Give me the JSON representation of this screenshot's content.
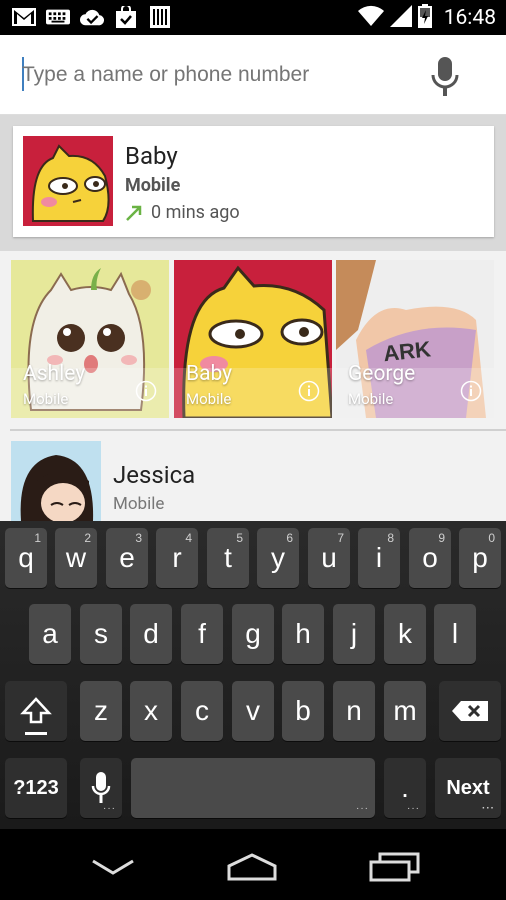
{
  "status_bar": {
    "time": "16:48",
    "left_icons": [
      "gmail-icon",
      "keyboard-icon",
      "check-cloud-icon",
      "shopping-bag-icon",
      "barcode-icon"
    ],
    "right_icons": [
      "wifi-icon",
      "cell-signal-icon",
      "battery-icon"
    ]
  },
  "search": {
    "placeholder": "Type a name or phone number",
    "value": ""
  },
  "recent": {
    "name": "Baby",
    "type": "Mobile",
    "time": "0 mins ago",
    "arrow_color": "#6ab344"
  },
  "favorites": [
    {
      "name": "Ashley",
      "type": "Mobile"
    },
    {
      "name": "Baby",
      "type": "Mobile"
    },
    {
      "name": "George",
      "type": "Mobile"
    }
  ],
  "contact": {
    "name": "Jessica",
    "type": "Mobile"
  },
  "keyboard": {
    "row1": [
      {
        "label": "q",
        "hint": "1"
      },
      {
        "label": "w",
        "hint": "2"
      },
      {
        "label": "e",
        "hint": "3"
      },
      {
        "label": "r",
        "hint": "4"
      },
      {
        "label": "t",
        "hint": "5"
      },
      {
        "label": "y",
        "hint": "6"
      },
      {
        "label": "u",
        "hint": "7"
      },
      {
        "label": "i",
        "hint": "8"
      },
      {
        "label": "o",
        "hint": "9"
      },
      {
        "label": "p",
        "hint": "0"
      }
    ],
    "row2": [
      "a",
      "s",
      "d",
      "f",
      "g",
      "h",
      "j",
      "k",
      "l"
    ],
    "row3": [
      "z",
      "x",
      "c",
      "v",
      "b",
      "n",
      "m"
    ],
    "symbols_label": "?123",
    "period_label": ".",
    "next_label": "Next"
  },
  "nav": [
    "back-icon",
    "home-icon",
    "recents-icon"
  ]
}
